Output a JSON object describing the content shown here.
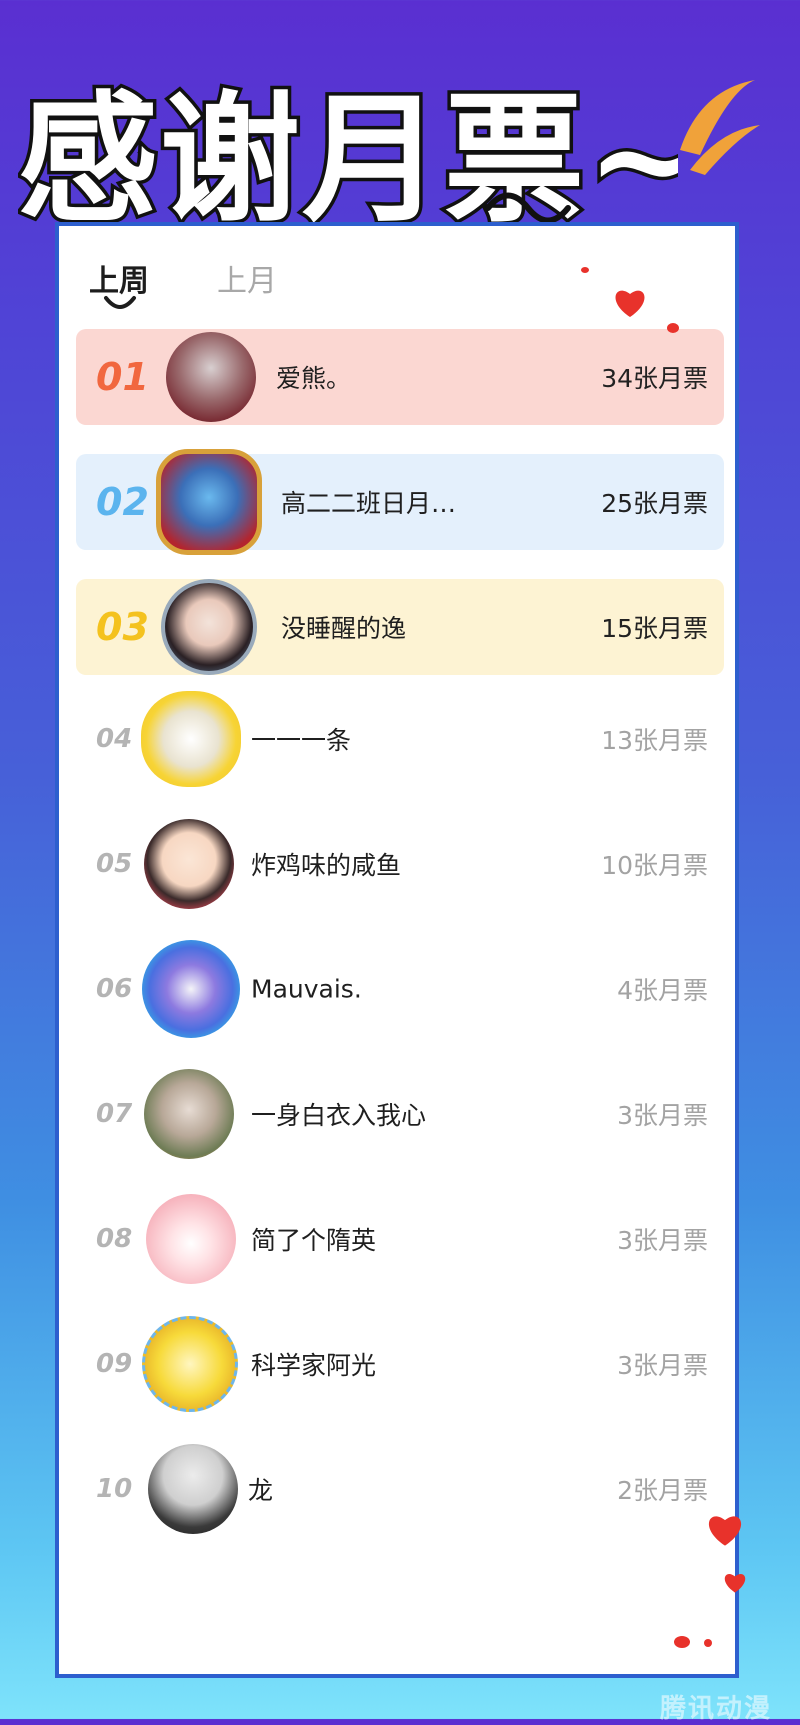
{
  "header": {
    "title": "感谢月票~"
  },
  "tabs": [
    {
      "label": "上周",
      "active": true
    },
    {
      "label": "上月",
      "active": false
    }
  ],
  "colors": {
    "accent_gold": "#f4c21e",
    "rank1": "#f1673f",
    "rank2": "#5bb4ee",
    "rank3": "#f4c21e",
    "row1_bg": "#fbd7d2",
    "row2_bg": "#e4f0fc",
    "row3_bg": "#fdf3d3",
    "heart": "#e8322b"
  },
  "ranking": [
    {
      "rank": "01",
      "name": "爱熊。",
      "votes": "34张月票",
      "avatar_icon": "avatar-red-hoodie"
    },
    {
      "rank": "02",
      "name": "高二二班日月…",
      "votes": "25张月票",
      "avatar_icon": "avatar-game-badge"
    },
    {
      "rank": "03",
      "name": "没睡醒的逸",
      "votes": "15张月票",
      "avatar_icon": "avatar-girl-flowers"
    },
    {
      "rank": "04",
      "name": "一一一条",
      "votes": "13张月票",
      "avatar_icon": "avatar-lemon-cartoon"
    },
    {
      "rank": "05",
      "name": "炸鸡味的咸鱼",
      "votes": "10张月票",
      "avatar_icon": "avatar-cool-boy"
    },
    {
      "rank": "06",
      "name": "Mauvais.",
      "votes": "4张月票",
      "avatar_icon": "avatar-neon-headphones"
    },
    {
      "rank": "07",
      "name": "一身白衣入我心",
      "votes": "3张月票",
      "avatar_icon": "avatar-anime-flowers"
    },
    {
      "rank": "08",
      "name": "简了个隋英",
      "votes": "3张月票",
      "avatar_icon": "avatar-pink-pig"
    },
    {
      "rank": "09",
      "name": "科学家阿光",
      "votes": "3张月票",
      "avatar_icon": "avatar-pikachu"
    },
    {
      "rank": "10",
      "name": "龙",
      "votes": "2张月票",
      "avatar_icon": "avatar-grey-hair-boy"
    }
  ],
  "watermark": "腾讯动漫"
}
